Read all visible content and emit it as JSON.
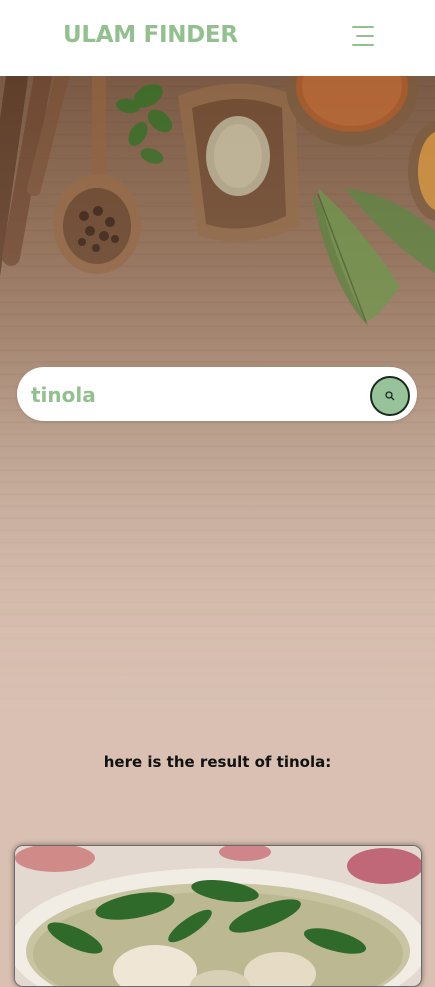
{
  "header": {
    "brand": "ULAM FINDER",
    "menu_icon": "hamburger-menu-icon"
  },
  "search": {
    "value": "tinola",
    "icon": "search-icon"
  },
  "results": {
    "heading": "here is the result of tinola:",
    "items": [
      {
        "image": "tinola-soup-photo"
      }
    ]
  },
  "colors": {
    "accent": "#93c08f",
    "search_button": "#98c39a",
    "page_background": "#d9c0b2",
    "header_background": "#ffffff"
  }
}
